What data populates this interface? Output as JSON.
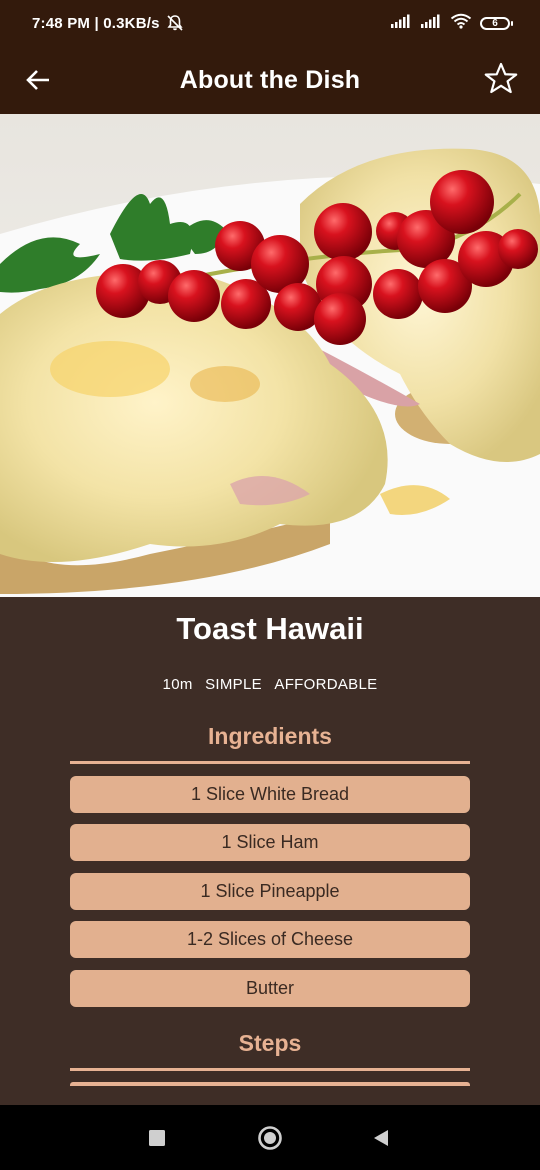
{
  "status_bar": {
    "time": "7:48 PM | 0.3KB/s",
    "battery": "6"
  },
  "app_bar": {
    "title": "About the Dish"
  },
  "dish": {
    "title": "Toast Hawaii",
    "duration": "10m",
    "complexity": "SIMPLE",
    "affordability": "AFFORDABLE"
  },
  "ingredients": {
    "heading": "Ingredients",
    "items": [
      "1 Slice White Bread",
      "1 Slice Ham",
      "1 Slice Pineapple",
      "1-2 Slices of Cheese",
      "Butter"
    ]
  },
  "steps": {
    "heading": "Steps"
  },
  "colors": {
    "app_bar": "#331a0c",
    "background": "#3e2d26",
    "accent": "#e7b293",
    "chip": "#e2b08f"
  },
  "icons": {
    "back": "arrow-left-icon",
    "favorite": "star-outline-icon",
    "nav_recent": "square-icon",
    "nav_home": "circle-icon",
    "nav_back": "triangle-left-icon"
  }
}
